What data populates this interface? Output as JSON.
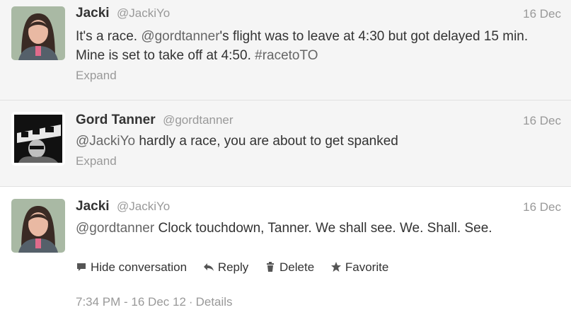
{
  "tweets": [
    {
      "fullname": "Jacki",
      "username": "@JackiYo",
      "timestamp": "16 Dec",
      "text_parts": [
        {
          "t": "It's a race. ",
          "hl": false
        },
        {
          "t": "@gordtanner",
          "hl": true
        },
        {
          "t": "'s flight was to leave at 4:30 but got delayed 15 min. Mine is set to take off at 4:50. ",
          "hl": false
        },
        {
          "t": "#racetoTO",
          "hl": true
        }
      ],
      "expand_label": "Expand"
    },
    {
      "fullname": "Gord Tanner",
      "username": "@gordtanner",
      "timestamp": "16 Dec",
      "text_parts": [
        {
          "t": "@JackiYo",
          "hl": true
        },
        {
          "t": " hardly a race, you are about to get spanked",
          "hl": false
        }
      ],
      "expand_label": "Expand"
    },
    {
      "fullname": "Jacki",
      "username": "@JackiYo",
      "timestamp": "16 Dec",
      "text_parts": [
        {
          "t": "@gordtanner",
          "hl": true
        },
        {
          "t": " Clock touchdown, Tanner. We shall see. We. Shall. See.",
          "hl": false
        }
      ],
      "actions": {
        "hide_conversation": "Hide conversation",
        "reply": "Reply",
        "delete": "Delete",
        "favorite": "Favorite"
      },
      "meta": {
        "datetime": "7:34 PM - 16 Dec 12",
        "separator": "·",
        "details": "Details"
      }
    }
  ],
  "colors": {
    "text": "#333333",
    "muted": "#999999",
    "collapsed_bg": "#f5f5f5"
  }
}
